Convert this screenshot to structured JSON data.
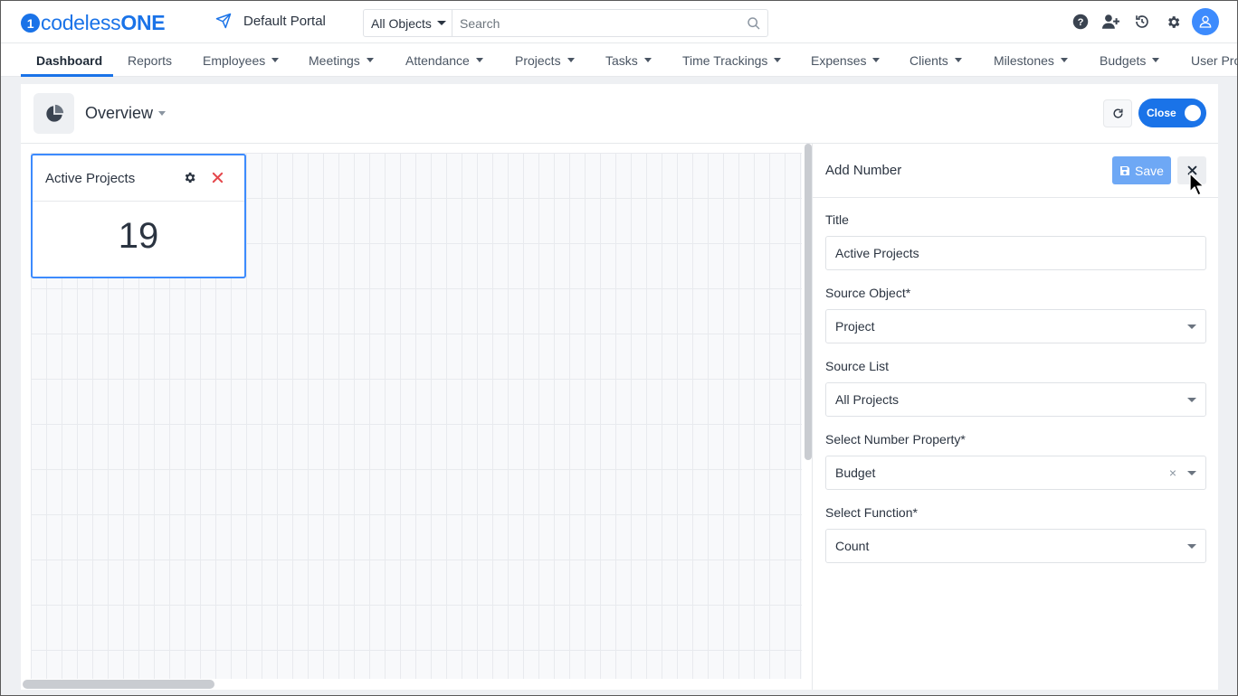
{
  "header": {
    "logo_prefix": "codeless",
    "logo_suffix": "ONE",
    "logo_mark": "1",
    "portal_name": "Default Portal",
    "search_scope": "All Objects",
    "search_placeholder": "Search",
    "icons": [
      "help-icon",
      "add-user-icon",
      "history-icon",
      "settings-icon",
      "user-avatar-icon"
    ]
  },
  "nav": {
    "items": [
      {
        "label": "Dashboard",
        "active": true
      },
      {
        "label": "Reports"
      },
      {
        "label": "Employees"
      },
      {
        "label": "Meetings"
      },
      {
        "label": "Attendance"
      },
      {
        "label": "Projects"
      },
      {
        "label": "Tasks"
      },
      {
        "label": "Time Trackings"
      },
      {
        "label": "Expenses"
      },
      {
        "label": "Clients"
      },
      {
        "label": "Milestones"
      },
      {
        "label": "Budgets"
      },
      {
        "label": "User Pro"
      }
    ]
  },
  "dashboard": {
    "title": "Overview",
    "toggle_label": "Close",
    "widget": {
      "title": "Active Projects",
      "value": "19"
    }
  },
  "side_panel": {
    "title": "Add Number",
    "save_label": "Save",
    "fields": {
      "title_label": "Title",
      "title_value": "Active Projects",
      "source_object_label": "Source Object*",
      "source_object_value": "Project",
      "source_list_label": "Source List",
      "source_list_value": "All Projects",
      "number_property_label": "Select Number Property*",
      "number_property_value": "Budget",
      "function_label": "Select Function*",
      "function_value": "Count"
    }
  },
  "colors": {
    "accent": "#1a73e8",
    "save_button": "#6ea8f5",
    "danger": "#e5484d"
  }
}
